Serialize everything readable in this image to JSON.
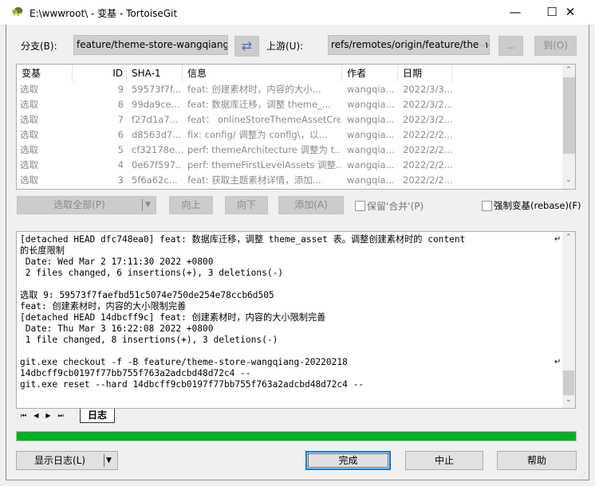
{
  "window": {
    "title": "E:\\wwwroot\\        - 变基 - TortoiseGit",
    "minimize": "—",
    "maximize": "☐",
    "close": "✕"
  },
  "branch": {
    "label": "分支(B):",
    "value": "feature/theme-store-wangqiang",
    "upstream_label": "上游(U):",
    "upstream_value": "refs/remotes/origin/feature/theme",
    "browse_label": "...",
    "to_label": "到(O)"
  },
  "list": {
    "columns": [
      "变基",
      "ID",
      "SHA-1",
      "信息",
      "作者",
      "日期"
    ],
    "rows": [
      [
        "选取",
        "9",
        "59573f7f...",
        "feat: 创建素材时，内容的大小...",
        "wangqia...",
        "2022/3/3..."
      ],
      [
        "选取",
        "8",
        "99da9ce...",
        "feat: 数据库迁移，调整 theme_...",
        "wangqia...",
        "2022/3/2..."
      ],
      [
        "选取",
        "7",
        "f27d1a7...",
        "feat： onlineStoreThemeAssetCre...",
        "wangqia...",
        "2022/3/2..."
      ],
      [
        "选取",
        "6",
        "d8563d7...",
        "fix: config/ 调整为 config\\，以...",
        "wangqia...",
        "2022/2/2..."
      ],
      [
        "选取",
        "5",
        "cf32178e...",
        "perf: themeArchitecture 调整为 t...",
        "wangqia...",
        "2022/2/2..."
      ],
      [
        "选取",
        "4",
        "0e67f597...",
        "perf: themeFirstLevelAssets 调整...",
        "wangqia...",
        "2022/2/2..."
      ],
      [
        "选取",
        "3",
        "5f6a62c...",
        "feat: 获取主题素材详情，添加...",
        "wangqia...",
        "2022/2/2..."
      ]
    ]
  },
  "actions": {
    "pick_all": "选取全部(P)",
    "up": "向上",
    "down": "向下",
    "add": "添加(A)",
    "preserve_merges": "保留'合并'(P)",
    "force_rebase": "强制变基(rebase)(F)"
  },
  "log": {
    "text": "[detached HEAD dfc748ea0] feat: 数据库迁移，调整 theme_asset 表。调整创建素材时的 content\n的长度限制\n Date: Wed Mar 2 17:11:30 2022 +0800\n 2 files changed, 6 insertions(+), 3 deletions(-)\n\n选取 9: 59573f7faefbd51c5074e750de254e78ccb6d505\nfeat: 创建素材时，内容的大小限制完善\n[detached HEAD 14dbcff9c] feat: 创建素材时，内容的大小限制完善\n Date: Thu Mar 3 16:22:08 2022 +0800\n 1 file changed, 8 insertions(+), 3 deletions(-)\n\ngit.exe checkout -f -B feature/theme-store-wangqiang-20220218\n14dbcff9cb0197f77bb755f763a2adcbd48d72c4 --\ngit.exe reset --hard 14dbcff9cb0197f77bb755f763a2adcbd48d72c4 --"
  },
  "tabs": {
    "active": "日志"
  },
  "progress": {
    "percent": 100,
    "color": "#06b025"
  },
  "footer": {
    "show_log": "显示日志(L)",
    "done": "完成",
    "abort": "中止",
    "help": "帮助"
  }
}
